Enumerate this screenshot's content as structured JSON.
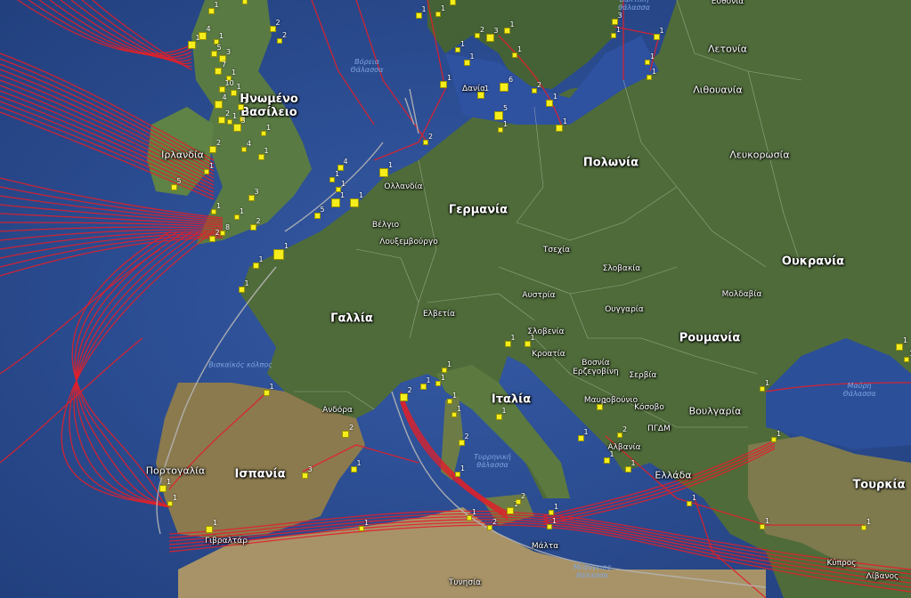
{
  "map": {
    "colors": {
      "sea": "#2f4f96",
      "land": "#4e6a3a",
      "cable": "#e0202a",
      "cable_gray": "#b5b5b5",
      "landing": "#f5ee1c"
    },
    "labels": [
      {
        "id": "uk",
        "text": "Ηνωμένο\nΒασίλειο",
        "cls": "big"
      },
      {
        "id": "ireland",
        "text": "Ιρλανδία",
        "cls": "country"
      },
      {
        "id": "netherlands",
        "text": "Ολλανδία",
        "cls": "small"
      },
      {
        "id": "belgium",
        "text": "Βέλγιο",
        "cls": "small"
      },
      {
        "id": "luxembourg",
        "text": "Λουξεμβούργο",
        "cls": "small"
      },
      {
        "id": "germany",
        "text": "Γερμανία",
        "cls": "big"
      },
      {
        "id": "poland",
        "text": "Πολωνία",
        "cls": "big"
      },
      {
        "id": "denmark",
        "text": "Δανία",
        "cls": "small"
      },
      {
        "id": "latvia",
        "text": "Λετονία",
        "cls": "country"
      },
      {
        "id": "lithuania",
        "text": "Λιθουανία",
        "cls": "country"
      },
      {
        "id": "belarus",
        "text": "Λευκορωσία",
        "cls": "country"
      },
      {
        "id": "ukraine",
        "text": "Ουκρανία",
        "cls": "big"
      },
      {
        "id": "moldova",
        "text": "Μολδαβία",
        "cls": "small"
      },
      {
        "id": "romania",
        "text": "Ρουμανία",
        "cls": "big"
      },
      {
        "id": "czech",
        "text": "Τσεχία",
        "cls": "small"
      },
      {
        "id": "slovakia",
        "text": "Σλοβακία",
        "cls": "small"
      },
      {
        "id": "austria",
        "text": "Αυστρία",
        "cls": "small"
      },
      {
        "id": "hungary",
        "text": "Ουγγαρία",
        "cls": "small"
      },
      {
        "id": "switzerland",
        "text": "Ελβετία",
        "cls": "small"
      },
      {
        "id": "france",
        "text": "Γαλλία",
        "cls": "big"
      },
      {
        "id": "slovenia",
        "text": "Σλοβενία",
        "cls": "small"
      },
      {
        "id": "croatia",
        "text": "Κροατία",
        "cls": "small"
      },
      {
        "id": "bosnia",
        "text": "Βοσνία\nΕρζεγοβίνη",
        "cls": "small"
      },
      {
        "id": "serbia",
        "text": "Σερβία",
        "cls": "small"
      },
      {
        "id": "montenegro",
        "text": "Μαυροβούνιο",
        "cls": "small"
      },
      {
        "id": "kosovo",
        "text": "Κόσοβο",
        "cls": "small"
      },
      {
        "id": "bulgaria",
        "text": "Βουλγαρία",
        "cls": "country"
      },
      {
        "id": "fyrom",
        "text": "ΠΓΔΜ",
        "cls": "small"
      },
      {
        "id": "albania",
        "text": "Αλβανία",
        "cls": "small"
      },
      {
        "id": "greece",
        "text": "Ελλάδα",
        "cls": "country"
      },
      {
        "id": "turkey",
        "text": "Τουρκία",
        "cls": "big"
      },
      {
        "id": "cyprus",
        "text": "Κύπρος",
        "cls": "small"
      },
      {
        "id": "lebanon",
        "text": "Λίβανος",
        "cls": "small"
      },
      {
        "id": "italy",
        "text": "Ιταλία",
        "cls": "big"
      },
      {
        "id": "andorra",
        "text": "Ανδόρα",
        "cls": "small"
      },
      {
        "id": "spain",
        "text": "Ισπανία",
        "cls": "big"
      },
      {
        "id": "portugal",
        "text": "Πορτογαλία",
        "cls": "country"
      },
      {
        "id": "gibraltar",
        "text": "Γιβραλτάρ",
        "cls": "small"
      },
      {
        "id": "malta",
        "text": "Μάλτα",
        "cls": "small"
      },
      {
        "id": "tunisia",
        "text": "Τυνησία",
        "cls": "small"
      },
      {
        "id": "estonia",
        "text": "Εσθονία",
        "cls": "small"
      },
      {
        "id": "black_sea",
        "text": "Μαύρη\nΘάλασσα",
        "cls": "sea"
      },
      {
        "id": "north_sea",
        "text": "Βόρεια\nΘάλασσα",
        "cls": "sea"
      },
      {
        "id": "baltic",
        "text": "Βαλτική\nθάλασσα",
        "cls": "sea"
      },
      {
        "id": "biscay",
        "text": "Βισκαϊκός κόλπος",
        "cls": "sea"
      },
      {
        "id": "tyrrhenian",
        "text": "Τυρρηνική\nθάλασσα",
        "cls": "sea"
      },
      {
        "id": "med",
        "text": "Μεσόγειος\nθάλασσα",
        "cls": "sea"
      }
    ],
    "landing_counts": [
      "1",
      "4",
      "1",
      "1",
      "5",
      "3",
      "7",
      "1",
      "10",
      "1",
      "4",
      "1",
      "2",
      "2",
      "1",
      "3",
      "1",
      "4",
      "1",
      "2",
      "1",
      "5",
      "1",
      "8",
      "2",
      "1",
      "3",
      "2",
      "1",
      "1",
      "1",
      "5",
      "1",
      "4",
      "1",
      "1",
      "1",
      "1",
      "2",
      "1",
      "6",
      "3",
      "1",
      "1",
      "5",
      "1",
      "1",
      "2",
      "1",
      "1",
      "2",
      "2",
      "1",
      "1",
      "1",
      "1",
      "2",
      "1",
      "1",
      "3",
      "1",
      "1",
      "1",
      "1",
      "1",
      "1",
      "1",
      "2",
      "1",
      "3",
      "1",
      "1",
      "1",
      "1",
      "2",
      "1",
      "1",
      "1",
      "1",
      "1",
      "2",
      "1",
      "1",
      "2",
      "1",
      "2",
      "1",
      "1",
      "1",
      "1",
      "1",
      "1",
      "2",
      "1",
      "1",
      "1",
      "1",
      "1",
      "1",
      "1",
      "1"
    ]
  }
}
